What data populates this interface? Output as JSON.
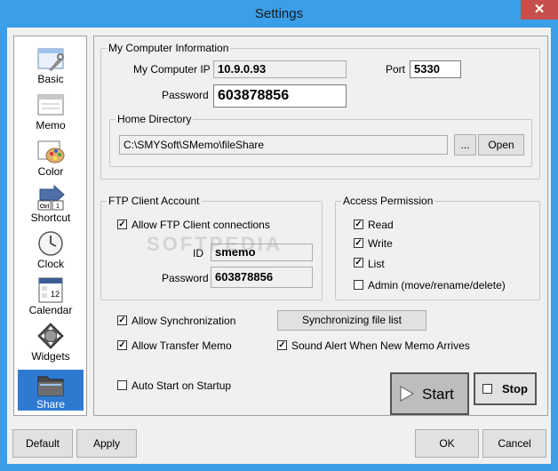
{
  "window": {
    "title": "Settings",
    "close_glyph": "✕"
  },
  "sidebar": {
    "items": [
      {
        "label": "Basic",
        "icon": "basic-icon"
      },
      {
        "label": "Memo",
        "icon": "memo-icon"
      },
      {
        "label": "Color",
        "icon": "color-palette-icon"
      },
      {
        "label": "Shortcut",
        "icon": "shortcut-icon"
      },
      {
        "label": "Clock",
        "icon": "clock-icon"
      },
      {
        "label": "Calendar",
        "icon": "calendar-icon"
      },
      {
        "label": "Widgets",
        "icon": "widgets-icon"
      },
      {
        "label": "Share",
        "icon": "share-folder-icon",
        "selected": true
      }
    ],
    "shortcut_key_text": "Ctrl",
    "shortcut_key_text2": "1",
    "calendar_day": "12"
  },
  "my_computer": {
    "legend": "My Computer Information",
    "ip_label": "My Computer IP",
    "ip_value": "10.9.0.93",
    "port_label": "Port",
    "port_value": "5330",
    "password_label": "Password",
    "password_value": "603878856",
    "home_dir": {
      "legend": "Home Directory",
      "path": "C:\\SMYSoft\\SMemo\\fileShare",
      "browse_label": "...",
      "open_label": "Open"
    }
  },
  "ftp_client": {
    "legend": "FTP Client Account",
    "allow_label": "Allow FTP Client connections",
    "allow_checked": true,
    "id_label": "ID",
    "id_value": "smemo",
    "password_label": "Password",
    "password_value": "603878856"
  },
  "access": {
    "legend": "Access Permission",
    "read_label": "Read",
    "read_checked": true,
    "write_label": "Write",
    "write_checked": true,
    "list_label": "List",
    "list_checked": true,
    "admin_label": "Admin (move/rename/delete)",
    "admin_checked": false
  },
  "options": {
    "sync_label": "Allow Synchronization",
    "sync_checked": true,
    "sync_list_button": "Synchronizing file list",
    "transfer_label": "Allow Transfer Memo",
    "transfer_checked": true,
    "sound_label": "Sound Alert When New Memo Arrives",
    "sound_checked": true,
    "autostart_label": "Auto Start on Startup",
    "autostart_checked": false
  },
  "server": {
    "start_label": "Start",
    "stop_label": "Stop"
  },
  "footer": {
    "default_label": "Default",
    "apply_label": "Apply",
    "ok_label": "OK",
    "cancel_label": "Cancel"
  },
  "watermark": "SOFTPEDIA",
  "colors": {
    "title_bar": "#3a9ee8",
    "selected_item": "#2f7ad1",
    "close_button": "#c7504c"
  }
}
